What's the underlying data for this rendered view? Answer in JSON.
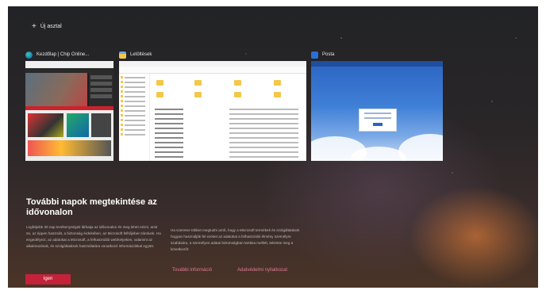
{
  "new_desktop": {
    "icon": "plus-icon",
    "label": "Új asztal"
  },
  "windows": [
    {
      "app": "edge",
      "icon": "edge-browser-icon",
      "title": "Kezdőlap | Chip Online..."
    },
    {
      "app": "explorer",
      "icon": "folder-icon",
      "title": "Letöltések"
    },
    {
      "app": "mail",
      "icon": "mail-icon",
      "title": "Posta"
    }
  ],
  "timeline_prompt": {
    "title": "További napok megtekintése az idővonalon",
    "paragraph_1": "Legfeljebb 30 nap tevékenységeit láthatja az idővonalon és meg lehet nézni, amit ön, az éppen használt, a biztonság érdekében, az Microsoft felhőjében tárolunk. Ha engedélyezi, az adatokat a Microsoft, a felhasználói webhelyeken, valamint az alkalmazások, és szolgáltatások használatára vonatkozó információkkal együtt.",
    "paragraph_2": "Ha szeretne többet megtudni arról, hogy a Microsoft termékek és szolgáltatások hogyan használják fel ezeket az adatokat a felhasználói élmény személyre szabására, a személyes adatai biztonságban tartása mellett, tekintse meg a következőt:",
    "link_more_info": "További információ",
    "link_privacy": "Adatvédelmi nyilatkozat",
    "yes_button": "Igen"
  },
  "colors": {
    "accent": "#c4223b",
    "link": "#e07a93"
  }
}
